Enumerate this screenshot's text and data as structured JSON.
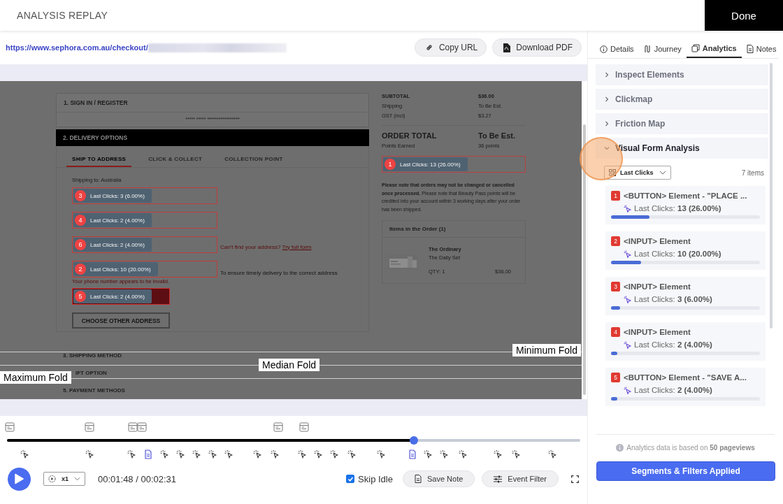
{
  "header": {
    "title": "ANALYSIS REPLAY",
    "done_button": "Done"
  },
  "url_bar": {
    "url": "https://www.sephora.com.au/checkout/",
    "buttons": [
      {
        "kind": "link",
        "label": "Copy URL"
      },
      {
        "kind": "pdf",
        "label": "Download PDF"
      }
    ]
  },
  "replay": {
    "sign_in": {
      "title": "1. SIGN IN / REGISTER",
      "masked_text": "***** ***** *****************"
    },
    "delivery": {
      "title": "2. DELIVERY OPTIONS",
      "tabs": [
        {
          "label": "SHIP TO ADDRESS",
          "selected": true
        },
        {
          "label": "CLICK & COLLECT",
          "selected": false
        },
        {
          "label": "COLLECTION POINT",
          "selected": false
        }
      ],
      "shipping_to": "Shipping to: Australia",
      "fields": [
        {
          "kind": "input",
          "badge": {
            "number": "3",
            "text": "Last Clicks: 3 (6.00%)"
          }
        },
        {
          "kind": "input",
          "badge": {
            "number": "4",
            "text": "Last Clicks: 2 (4.00%)"
          }
        },
        {
          "kind": "input",
          "badge": {
            "number": "6",
            "text": "Last Clicks: 2 (4.00%)"
          },
          "hint": "Can't find your address?",
          "hint_link": "Try full form"
        },
        {
          "kind": "input",
          "badge": {
            "number": "2",
            "text": "Last Clicks: 10 (20.00%)"
          },
          "hint": "To ensure timely delivery to the correct address",
          "error": "Your phone number appears to be invalid."
        },
        {
          "kind": "button",
          "badge": {
            "number": "5",
            "text": "Last Clicks: 2 (4.00%)"
          }
        }
      ],
      "choose_button": "CHOOSE OTHER ADDRESS"
    },
    "sections": [
      "3. SHIPPING METHOD",
      "IFT OPTION",
      "5. PAYMENT METHODS"
    ],
    "summary": {
      "rows": [
        {
          "kind": "bold",
          "label": "SUBTOTAL",
          "value": "$36.00"
        },
        {
          "kind": "plain",
          "label": "Shipping",
          "value": "To Be Est."
        },
        {
          "kind": "plain",
          "label": "GST (incl)",
          "value": "$3.27"
        }
      ],
      "total_label": "ORDER TOTAL",
      "total_value": "To Be Est.",
      "points_label": "Points Earned",
      "points_value": "36 points",
      "place_badge": {
        "number": "1",
        "text": "Last Clicks: 13 (26.00%)"
      },
      "note": "**Please note that orders may not be changed or cancelled once processed.** Please note that Beauty Pass points will be credited into your account within 3 working days after your order has been shipped.",
      "order": {
        "title": "Items in the Order (1)",
        "brand": "The Ordinary",
        "product": "The Daily Set",
        "qty": "QTY: 1",
        "price": "$36.00"
      }
    },
    "folds": [
      {
        "kind": "minimum",
        "label": "Minimum Fold"
      },
      {
        "kind": "median",
        "label": "Median Fold"
      },
      {
        "kind": "maximum",
        "label": "Maximum Fold"
      }
    ]
  },
  "timeline": {
    "level": 0.71
  },
  "controls": {
    "speed": "x1",
    "time": "00:01:48 / 00:02:31",
    "skip_idle": {
      "label": "Skip Idle",
      "checked": true
    },
    "buttons": [
      {
        "kind": "note",
        "label": "Save Note"
      },
      {
        "kind": "filter",
        "label": "Event Filter"
      }
    ]
  },
  "sidebar": {
    "tabs": [
      {
        "kind": "info",
        "label": "Details",
        "selected": false
      },
      {
        "kind": "journey",
        "label": "Journey",
        "selected": false
      },
      {
        "kind": "analytics",
        "label": "Analytics",
        "selected": true
      },
      {
        "kind": "notes",
        "label": "Notes",
        "selected": false
      }
    ],
    "sections": [
      {
        "title": "Inspect Elements",
        "expanded": false
      },
      {
        "title": "Clickmap",
        "expanded": false
      },
      {
        "title": "Friction Map",
        "expanded": false
      },
      {
        "title": "Visual Form Analysis",
        "expanded": true
      }
    ],
    "metric_select": "Last Clicks",
    "item_count": "7 items",
    "items": [
      {
        "number": "1",
        "title": "<BUTTON> Element - \"PLACE ...",
        "metric_label": "Last Clicks:",
        "metric_value": "13 (26.00%)",
        "level": 0.26
      },
      {
        "number": "2",
        "title": "<INPUT> Element",
        "metric_label": "Last Clicks:",
        "metric_value": "10 (20.00%)",
        "level": 0.2
      },
      {
        "number": "3",
        "title": "<INPUT> Element",
        "metric_label": "Last Clicks:",
        "metric_value": "3 (6.00%)",
        "level": 0.06
      },
      {
        "number": "4",
        "title": "<INPUT> Element",
        "metric_label": "Last Clicks:",
        "metric_value": "2 (4.00%)",
        "level": 0.04
      },
      {
        "number": "5",
        "title": "<BUTTON> Element - \"SAVE A...",
        "metric_label": "Last Clicks:",
        "metric_value": "2 (4.00%)",
        "level": 0.04
      }
    ],
    "footnote": "Analytics data is based on **50 pageviews**",
    "apply_button": "Segments & Filters Applied"
  }
}
